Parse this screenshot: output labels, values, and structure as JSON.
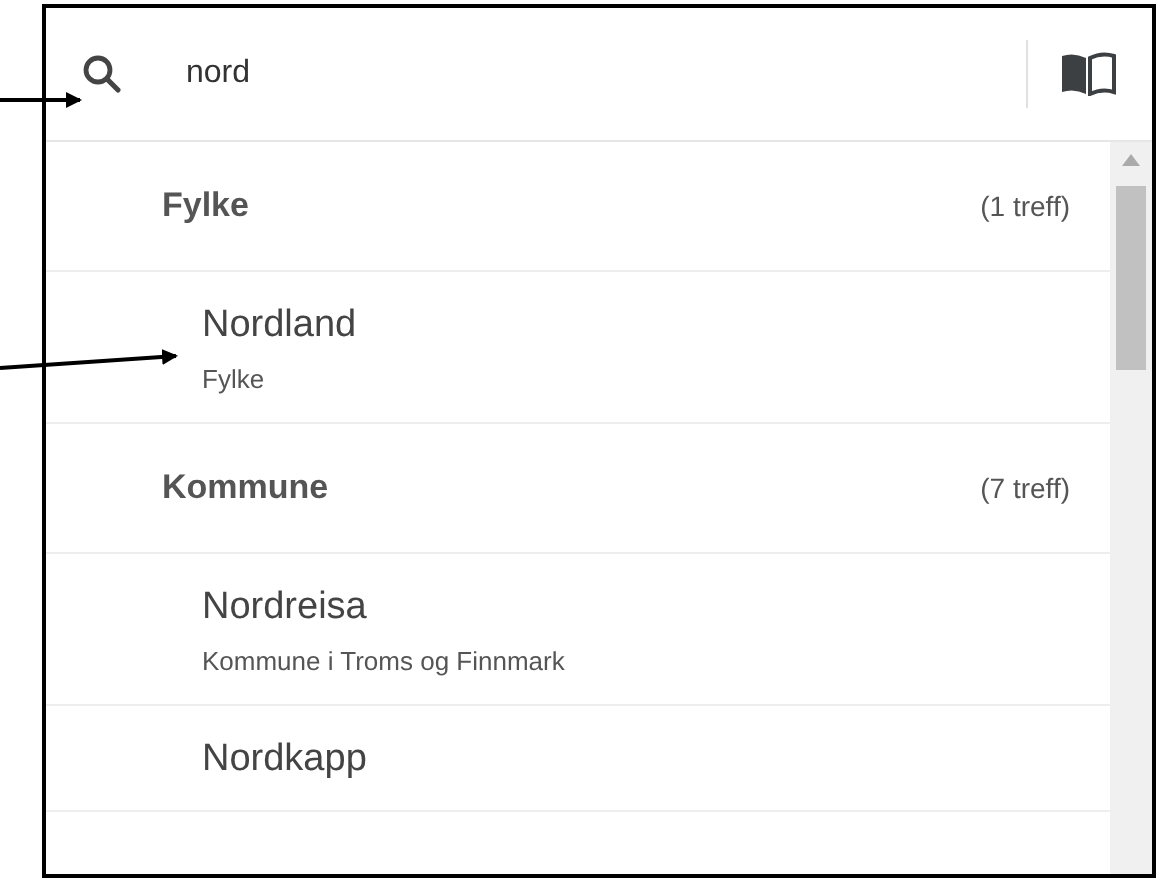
{
  "search": {
    "value": "nord"
  },
  "groups": [
    {
      "title": "Fylke",
      "count": "(1 treff)",
      "results": [
        {
          "name": "Nordland",
          "description": "Fylke"
        }
      ]
    },
    {
      "title": "Kommune",
      "count": "(7 treff)",
      "results": [
        {
          "name": "Nordreisa",
          "description": "Kommune i Troms og Finnmark"
        },
        {
          "name": "Nordkapp"
        }
      ]
    }
  ]
}
